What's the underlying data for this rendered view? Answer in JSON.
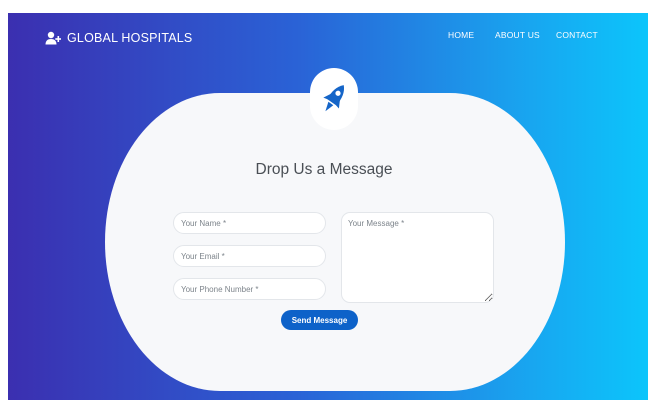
{
  "brand": {
    "name": "GLOBAL HOSPITALS",
    "icon": "user-plus-icon"
  },
  "nav": {
    "items": [
      "HOME",
      "ABOUT US",
      "CONTACT"
    ]
  },
  "form": {
    "badge_icon": "rocket-icon",
    "title": "Drop Us a Message",
    "name_placeholder": "Your Name *",
    "email_placeholder": "Your Email *",
    "phone_placeholder": "Your Phone Number *",
    "message_placeholder": "Your Message *",
    "submit_label": "Send Message"
  },
  "colors": {
    "gradient_start": "#3b2fb0",
    "gradient_end": "#0cc5fb",
    "accent": "#0d62c9",
    "card": "#f7f8fa"
  }
}
